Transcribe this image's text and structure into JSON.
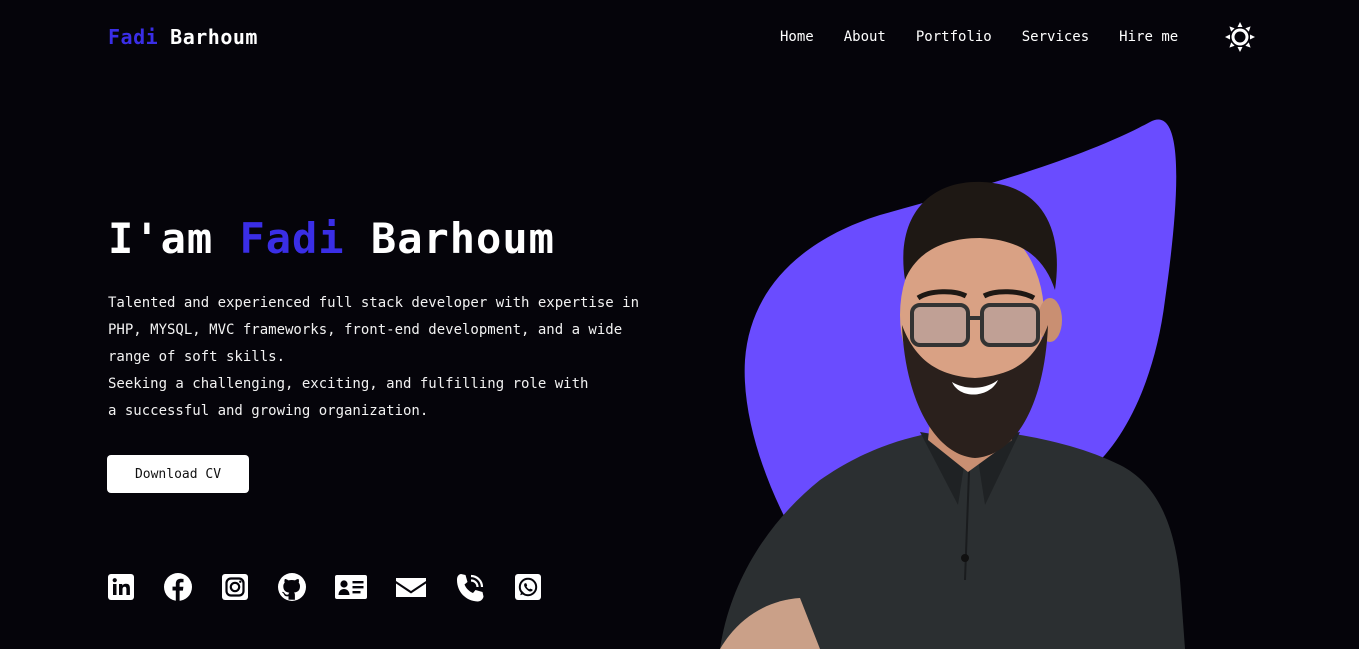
{
  "header": {
    "brand_first": "Fadi",
    "brand_last": "Barhoum",
    "nav": [
      "Home",
      "About",
      "Portfolio",
      "Services",
      "Hire me"
    ],
    "theme_icon": "sun-icon"
  },
  "hero": {
    "greeting": "I'am",
    "name_first": "Fadi",
    "name_last": "Barhoum",
    "description_lines": [
      "Talented and experienced full stack developer with expertise in",
      "PHP, MYSQL, MVC frameworks, front-end development, and a wide",
      "range of soft skills.",
      "Seeking a challenging, exciting, and fulfilling role with",
      "a successful and growing organization."
    ],
    "cta_label": "Download CV"
  },
  "socials": [
    "linkedin-icon",
    "facebook-icon",
    "instagram-icon",
    "github-icon",
    "contact-card-icon",
    "email-icon",
    "phone-icon",
    "whatsapp-icon"
  ],
  "colors": {
    "background": "#05040a",
    "accent": "#3a2ee6",
    "blob": "#6a4cff"
  }
}
